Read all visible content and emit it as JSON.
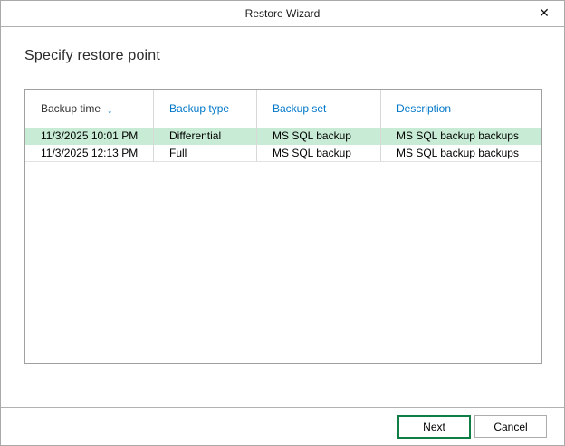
{
  "dialog": {
    "title": "Restore Wizard",
    "close_icon": "✕"
  },
  "page": {
    "heading": "Specify restore point"
  },
  "table": {
    "columns": [
      {
        "label": "Backup time",
        "sorted": "descending",
        "sort_icon": "↓"
      },
      {
        "label": "Backup type"
      },
      {
        "label": "Backup set"
      },
      {
        "label": "Description"
      }
    ],
    "rows": [
      {
        "backup_time": "11/3/2025 10:01 PM",
        "backup_type": "Differential",
        "backup_set": "MS SQL backup",
        "description": "MS SQL backup backups",
        "selected": true
      },
      {
        "backup_time": "11/3/2025 12:13 PM",
        "backup_type": "Full",
        "backup_set": "MS SQL backup",
        "description": "MS SQL backup backups",
        "selected": false
      }
    ]
  },
  "footer": {
    "next_label": "Next",
    "cancel_label": "Cancel"
  },
  "colors": {
    "selection_green": "#c7ebd4",
    "header_link_blue": "#0077c8",
    "next_button_border_green": "#107c46"
  }
}
